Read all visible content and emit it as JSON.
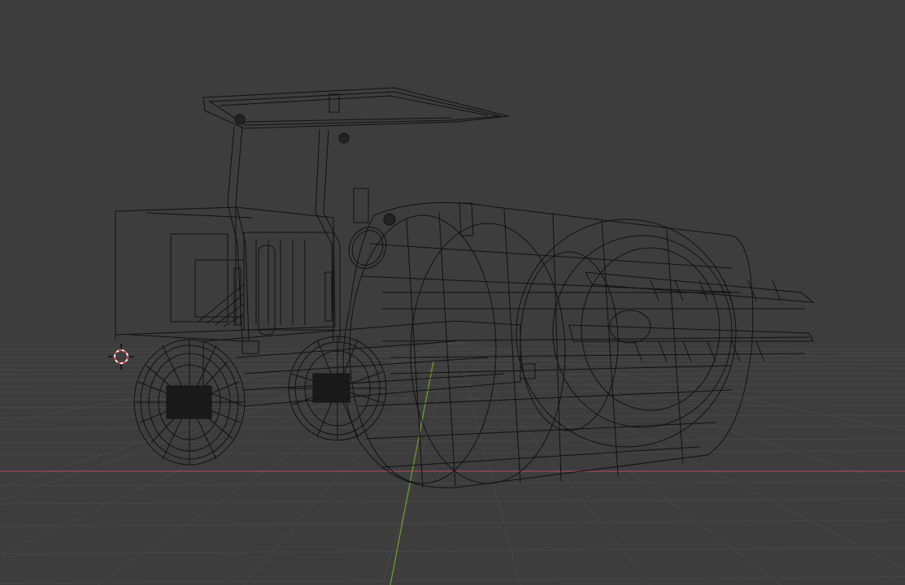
{
  "viewport": {
    "mode": "wireframe",
    "background_color": "#3d3d3d",
    "grid_color": "#4a4a4a",
    "x_axis_color": "#a3485a",
    "y_axis_color": "#6f9a2f",
    "wire_color": "#111111",
    "cursor_color": "#e84a4a"
  },
  "scene": {
    "object": "road-roller-wireframe",
    "icons": [
      "3d-cursor-icon"
    ]
  }
}
